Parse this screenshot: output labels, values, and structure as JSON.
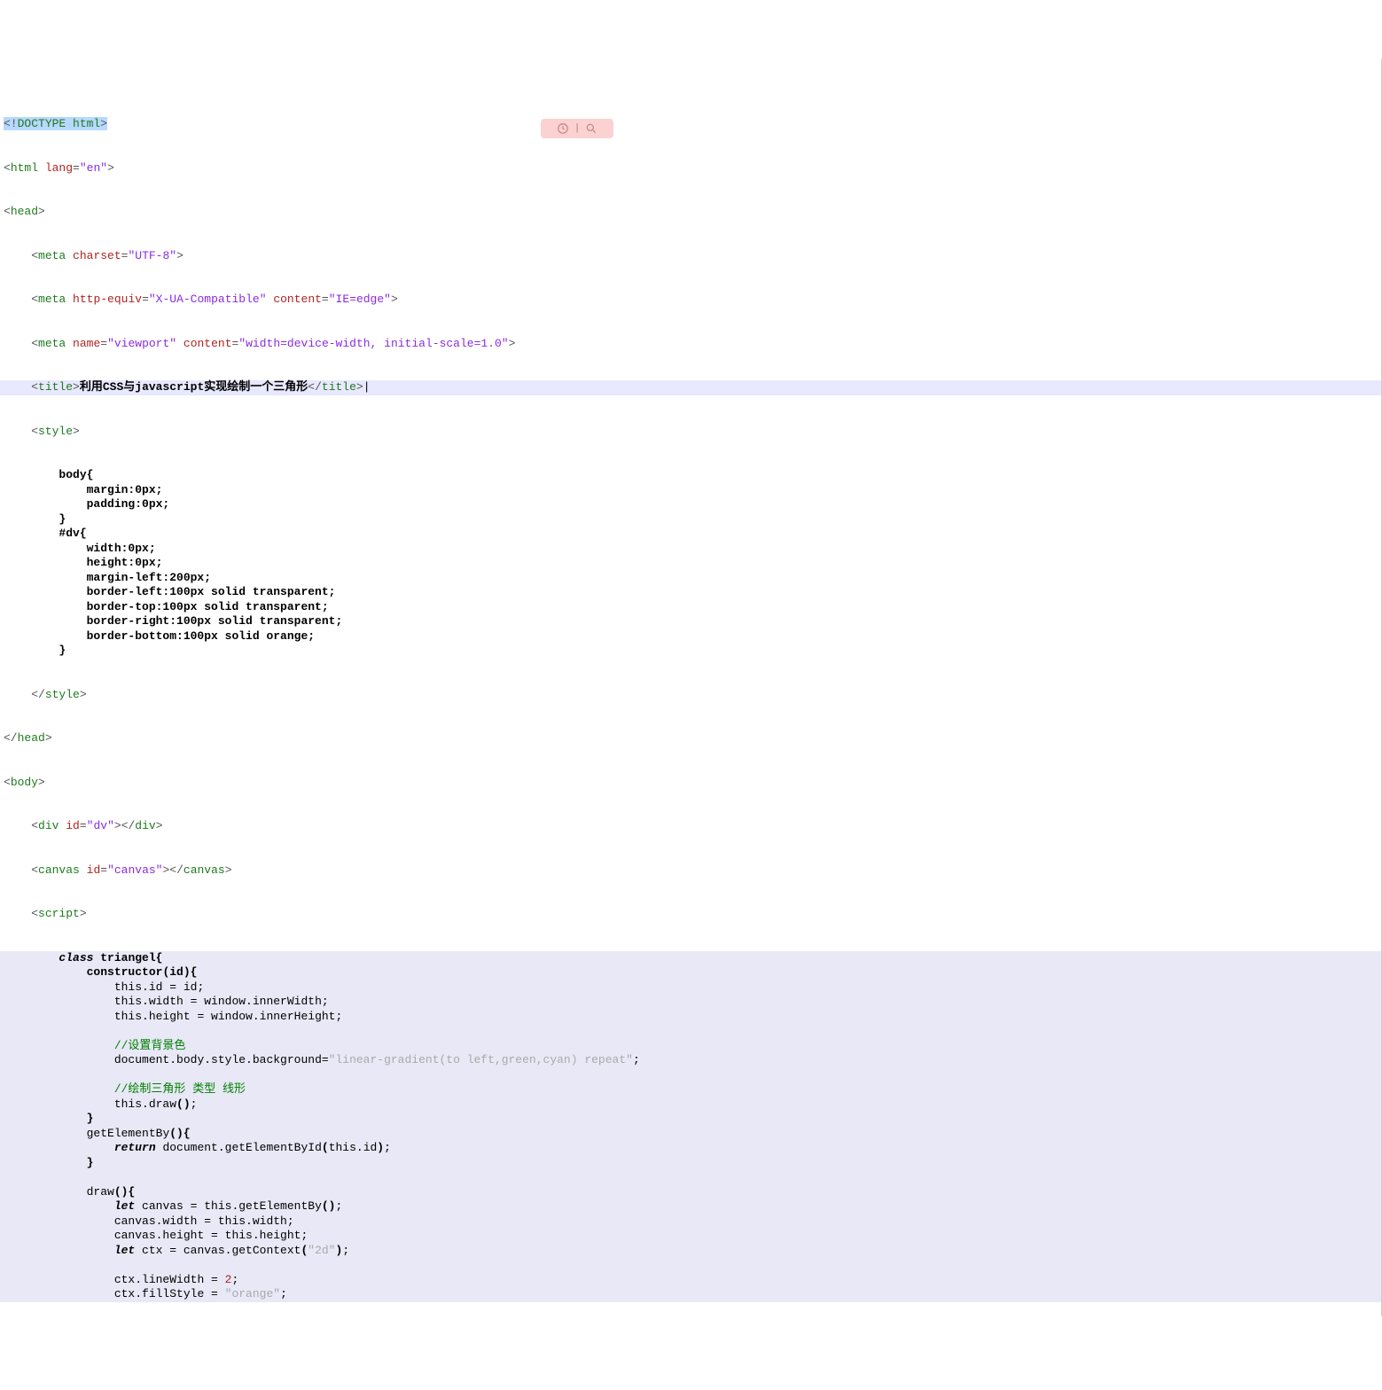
{
  "code": {
    "doctype": "<!DOCTYPE html>",
    "line2": {
      "open": "<html ",
      "attr": "lang",
      "eq": "=",
      "val": "\"en\"",
      "close": ">"
    },
    "line3": "<head>",
    "line4": {
      "indent": "    ",
      "open": "<meta ",
      "a1": "charset",
      "v1": "\"UTF-8\"",
      "close": ">"
    },
    "line5": {
      "indent": "    ",
      "open": "<meta ",
      "a1": "http-equiv",
      "v1": "\"X-UA-Compatible\"",
      "a2": "content",
      "v2": "\"IE=edge\"",
      "close": ">"
    },
    "line6": {
      "indent": "    ",
      "open": "<meta ",
      "a1": "name",
      "v1": "\"viewport\"",
      "a2": "content",
      "v2": "\"width=device-width, initial-scale=1.0\"",
      "close": ">"
    },
    "line7": {
      "indent": "    ",
      "open": "<title>",
      "text": "利用CSS与javascript实现绘制一个三角形",
      "close": "</title>"
    },
    "line8": {
      "indent": "    ",
      "open": "<style>"
    },
    "css": [
      "        body{",
      "            margin:0px;",
      "            padding:0px;",
      "        }",
      "        #dv{",
      "            width:0px;",
      "            height:0px;",
      "            margin-left:200px;",
      "            border-left:100px solid transparent;",
      "            border-top:100px solid transparent;",
      "            border-right:100px solid transparent;",
      "            border-bottom:100px solid orange;",
      "        }"
    ],
    "line22": {
      "indent": "    ",
      "close": "</style>"
    },
    "line23": "</head>",
    "line24": "<body>",
    "line25": {
      "indent": "    ",
      "open": "<div ",
      "a1": "id",
      "v1": "\"dv\"",
      "mid": ">",
      "close": "</div>"
    },
    "line26": {
      "indent": "    ",
      "open": "<canvas ",
      "a1": "id",
      "v1": "\"canvas\"",
      "mid": ">",
      "close": "</canvas>"
    },
    "line27": {
      "indent": "    ",
      "open": "<script>"
    },
    "script": [
      {
        "t": "plain",
        "indent": "        ",
        "parts": [
          {
            "c": "kw",
            "s": "class"
          },
          {
            "c": "bold",
            "s": " triangel{"
          }
        ]
      },
      {
        "t": "plain",
        "indent": "            ",
        "parts": [
          {
            "c": "bold",
            "s": "constructor(id){"
          }
        ]
      },
      {
        "t": "plain",
        "indent": "                ",
        "parts": [
          {
            "c": "txt",
            "s": "this.id = id;"
          }
        ]
      },
      {
        "t": "plain",
        "indent": "                ",
        "parts": [
          {
            "c": "txt",
            "s": "this.width = window.innerWidth;"
          }
        ]
      },
      {
        "t": "plain",
        "indent": "                ",
        "parts": [
          {
            "c": "txt",
            "s": "this.height = window.innerHeight;"
          }
        ]
      },
      {
        "t": "blank"
      },
      {
        "t": "plain",
        "indent": "                ",
        "parts": [
          {
            "c": "comment",
            "s": "//设置背景色"
          }
        ]
      },
      {
        "t": "plain",
        "indent": "                ",
        "parts": [
          {
            "c": "txt",
            "s": "document.body.style.background="
          },
          {
            "c": "str",
            "s": "\"linear-gradient(to left,green,cyan) repeat\""
          },
          {
            "c": "txt",
            "s": ";"
          }
        ]
      },
      {
        "t": "blank"
      },
      {
        "t": "plain",
        "indent": "                ",
        "parts": [
          {
            "c": "comment",
            "s": "//绘制三角形 类型 线形"
          }
        ]
      },
      {
        "t": "plain",
        "indent": "                ",
        "parts": [
          {
            "c": "txt",
            "s": "this.draw"
          },
          {
            "c": "bold",
            "s": "()"
          },
          {
            "c": "txt",
            "s": ";"
          }
        ]
      },
      {
        "t": "plain",
        "indent": "            ",
        "parts": [
          {
            "c": "bold",
            "s": "}"
          }
        ]
      },
      {
        "t": "plain",
        "indent": "            ",
        "parts": [
          {
            "c": "txt",
            "s": "getElementBy"
          },
          {
            "c": "bold",
            "s": "(){"
          }
        ]
      },
      {
        "t": "plain",
        "indent": "                ",
        "parts": [
          {
            "c": "kw",
            "s": "return"
          },
          {
            "c": "txt",
            "s": " document.getElementById"
          },
          {
            "c": "bold",
            "s": "("
          },
          {
            "c": "txt",
            "s": "this.id"
          },
          {
            "c": "bold",
            "s": ")"
          },
          {
            "c": "txt",
            "s": ";"
          }
        ]
      },
      {
        "t": "plain",
        "indent": "            ",
        "parts": [
          {
            "c": "bold",
            "s": "}"
          }
        ]
      },
      {
        "t": "blank"
      },
      {
        "t": "plain",
        "indent": "            ",
        "parts": [
          {
            "c": "txt",
            "s": "draw"
          },
          {
            "c": "bold",
            "s": "(){"
          }
        ]
      },
      {
        "t": "plain",
        "indent": "                ",
        "parts": [
          {
            "c": "kw",
            "s": "let"
          },
          {
            "c": "txt",
            "s": " canvas = this.getElementBy"
          },
          {
            "c": "bold",
            "s": "()"
          },
          {
            "c": "txt",
            "s": ";"
          }
        ]
      },
      {
        "t": "plain",
        "indent": "                ",
        "parts": [
          {
            "c": "txt",
            "s": "canvas.width = this.width;"
          }
        ]
      },
      {
        "t": "plain",
        "indent": "                ",
        "parts": [
          {
            "c": "txt",
            "s": "canvas.height = this.height;"
          }
        ]
      },
      {
        "t": "plain",
        "indent": "                ",
        "parts": [
          {
            "c": "kw",
            "s": "let"
          },
          {
            "c": "txt",
            "s": " ctx = canvas.getContext"
          },
          {
            "c": "bold",
            "s": "("
          },
          {
            "c": "str",
            "s": "\"2d\""
          },
          {
            "c": "bold",
            "s": ")"
          },
          {
            "c": "txt",
            "s": ";"
          }
        ]
      },
      {
        "t": "blank"
      },
      {
        "t": "plain",
        "indent": "                ",
        "parts": [
          {
            "c": "txt",
            "s": "ctx.lineWidth = "
          },
          {
            "c": "num",
            "s": "2"
          },
          {
            "c": "txt",
            "s": ";"
          }
        ]
      },
      {
        "t": "plain",
        "indent": "                ",
        "parts": [
          {
            "c": "txt",
            "s": "ctx.fillStyle = "
          },
          {
            "c": "str",
            "s": "\"orange\""
          },
          {
            "c": "txt",
            "s": ";"
          }
        ]
      }
    ]
  },
  "overlay": {
    "left_icon": "assist-icon",
    "right_icon": "search-icon"
  }
}
